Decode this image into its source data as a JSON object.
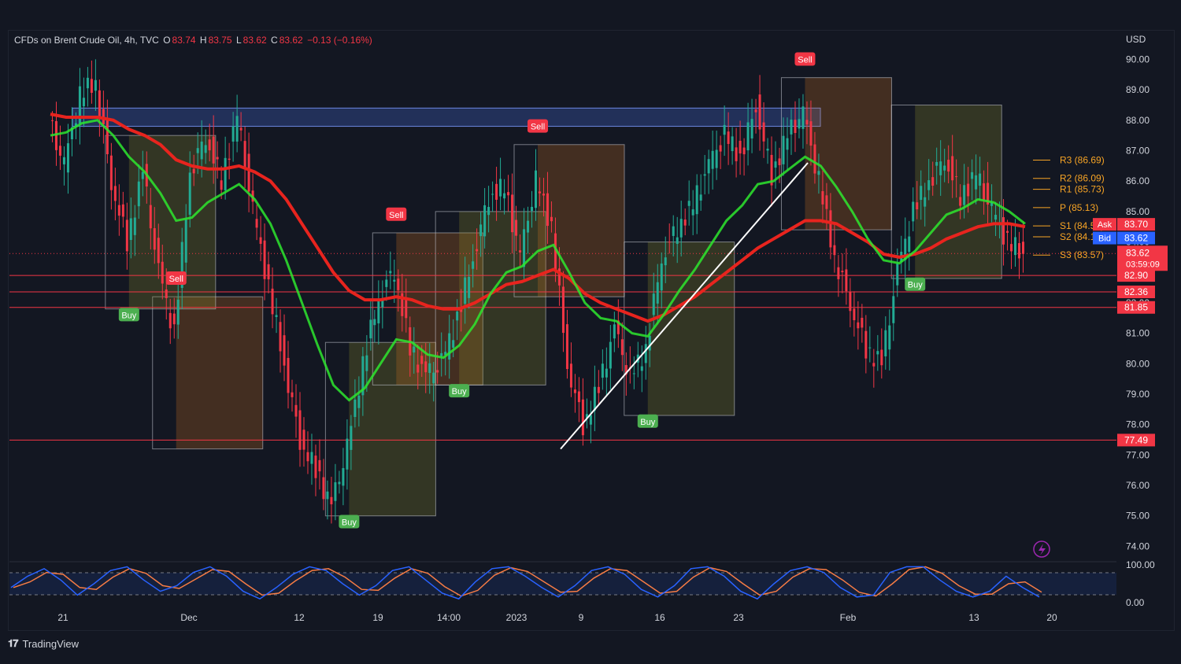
{
  "header": {
    "symbol": "CFDs on Brent Crude Oil, 4h, TVC",
    "open_label": "O",
    "open": "83.74",
    "high_label": "H",
    "high": "83.75",
    "low_label": "L",
    "low": "83.62",
    "close_label": "C",
    "close": "83.62",
    "change": "−0.13 (−0.16%)"
  },
  "currency": "USD",
  "brand": "TradingView",
  "chart_data": {
    "type": "line",
    "title": "CFDs on Brent Crude Oil, 4h, TVC",
    "y_axis": {
      "range": [
        73.7,
        90.4
      ],
      "ticks": [
        "90.00",
        "89.00",
        "88.00",
        "87.00",
        "86.00",
        "85.00",
        "84.00",
        "83.00",
        "82.00",
        "81.00",
        "80.00",
        "79.00",
        "78.00",
        "77.00",
        "76.00",
        "75.00",
        "74.00"
      ]
    },
    "x_axis": {
      "ticks": [
        "21",
        "Dec",
        "12",
        "19",
        "14:00",
        "2023",
        "9",
        "16",
        "23",
        "Feb",
        "13",
        "20"
      ]
    },
    "price_series": {
      "name": "Brent",
      "values": [
        88.0,
        86.5,
        88.8,
        89.3,
        86.0,
        84.0,
        86.3,
        83.0,
        81.0,
        86.3,
        87.5,
        86.0,
        88.1,
        85.0,
        82.5,
        80.0,
        77.5,
        76.5,
        75.3,
        77.2,
        80.0,
        82.2,
        83.1,
        80.5,
        79.6,
        80.0,
        81.5,
        83.5,
        85.5,
        85.8,
        83.5,
        86.0,
        84.5,
        80.0,
        78.0,
        79.2,
        81.1,
        79.5,
        80.5,
        83.5,
        84.5,
        85.2,
        86.5,
        87.5,
        86.8,
        88.5,
        86.2,
        87.5,
        88.2,
        86.0,
        83.5,
        82.0,
        80.5,
        80.0,
        83.0,
        85.0,
        86.0,
        86.8,
        85.5,
        86.2,
        85.0,
        84.0,
        83.62
      ]
    },
    "ema_fast": [
      87.5,
      87.6,
      87.9,
      88.0,
      87.5,
      86.8,
      86.3,
      85.6,
      84.7,
      84.8,
      85.3,
      85.6,
      85.9,
      85.4,
      84.6,
      83.4,
      82.0,
      80.6,
      79.3,
      78.8,
      79.2,
      80.0,
      80.8,
      80.7,
      80.3,
      80.2,
      80.6,
      81.3,
      82.3,
      83.0,
      83.2,
      83.7,
      83.9,
      83.0,
      82.0,
      81.5,
      81.4,
      81.0,
      80.9,
      81.6,
      82.4,
      83.1,
      83.9,
      84.7,
      85.2,
      85.9,
      86.0,
      86.4,
      86.8,
      86.5,
      85.8,
      85.0,
      84.1,
      83.4,
      83.3,
      83.7,
      84.3,
      84.9,
      85.1,
      85.4,
      85.3,
      85.0,
      84.6
    ],
    "ema_slow": [
      88.2,
      88.1,
      88.1,
      88.1,
      88.0,
      87.7,
      87.5,
      87.2,
      86.7,
      86.5,
      86.4,
      86.4,
      86.5,
      86.3,
      86.0,
      85.4,
      84.6,
      83.8,
      83.0,
      82.4,
      82.1,
      82.1,
      82.2,
      82.1,
      81.9,
      81.8,
      81.8,
      82.0,
      82.3,
      82.6,
      82.7,
      82.9,
      83.1,
      82.8,
      82.3,
      82.0,
      81.8,
      81.6,
      81.4,
      81.6,
      81.9,
      82.2,
      82.6,
      83.0,
      83.4,
      83.8,
      84.1,
      84.4,
      84.7,
      84.7,
      84.6,
      84.3,
      84.0,
      83.6,
      83.5,
      83.6,
      83.8,
      84.1,
      84.3,
      84.5,
      84.6,
      84.6,
      84.5
    ],
    "signals": [
      {
        "label": "Sell",
        "index": 8
      },
      {
        "label": "Buy",
        "index": 5
      },
      {
        "label": "Buy",
        "index": 19
      },
      {
        "label": "Sell",
        "index": 22
      },
      {
        "label": "Buy",
        "index": 26
      },
      {
        "label": "Sell",
        "index": 31
      },
      {
        "label": "Buy",
        "index": 38
      },
      {
        "label": "Sell",
        "index": 48
      },
      {
        "label": "Buy",
        "index": 55
      }
    ],
    "pivots": [
      {
        "label": "R3 (86.69)",
        "value": 86.69
      },
      {
        "label": "R2 (86.09)",
        "value": 86.09
      },
      {
        "label": "R1 (85.73)",
        "value": 85.73
      },
      {
        "label": "P (85.13)",
        "value": 85.13
      },
      {
        "label": "S1 (84.53)",
        "value": 84.53
      },
      {
        "label": "S2 (84.17)",
        "value": 84.17
      },
      {
        "label": "S3 (83.57)",
        "value": 83.57
      }
    ],
    "horizontal_levels": [
      {
        "value": 82.9,
        "label": "82.90"
      },
      {
        "value": 82.36,
        "label": "82.36"
      },
      {
        "value": 81.85,
        "label": "81.85"
      },
      {
        "value": 77.49,
        "label": "77.49"
      }
    ],
    "resistance_zone": [
      87.8,
      88.4
    ],
    "price_tags": [
      {
        "name": "Ask",
        "value": "83.70",
        "color": "#f23645"
      },
      {
        "name": "Bid",
        "value": "83.62",
        "color": "#2962ff"
      },
      {
        "name": "Last",
        "value": "83.62",
        "color": "#f23645"
      }
    ],
    "countdown": "03:59:09",
    "oscillator": {
      "ticks": [
        "100.00",
        "0.00"
      ],
      "values": [
        40,
        70,
        90,
        60,
        20,
        50,
        85,
        95,
        60,
        30,
        45,
        80,
        95,
        70,
        30,
        10,
        40,
        75,
        95,
        85,
        50,
        20,
        45,
        85,
        95,
        60,
        25,
        10,
        55,
        90,
        95,
        70,
        40,
        15,
        45,
        85,
        95,
        75,
        35,
        15,
        45,
        90,
        95,
        70,
        30,
        10,
        50,
        85,
        95,
        80,
        40,
        15,
        20,
        80,
        95,
        95,
        60,
        30,
        15,
        30,
        70,
        40,
        15
      ]
    },
    "colors": {
      "bull": "#22ab94",
      "bear": "#f23645",
      "ema_fast": "#2ee62e",
      "ema_slow": "#e8241e",
      "pivot": "#f7a425",
      "oscillator_k": "#2962ff",
      "oscillator_d": "#f77c44"
    }
  }
}
